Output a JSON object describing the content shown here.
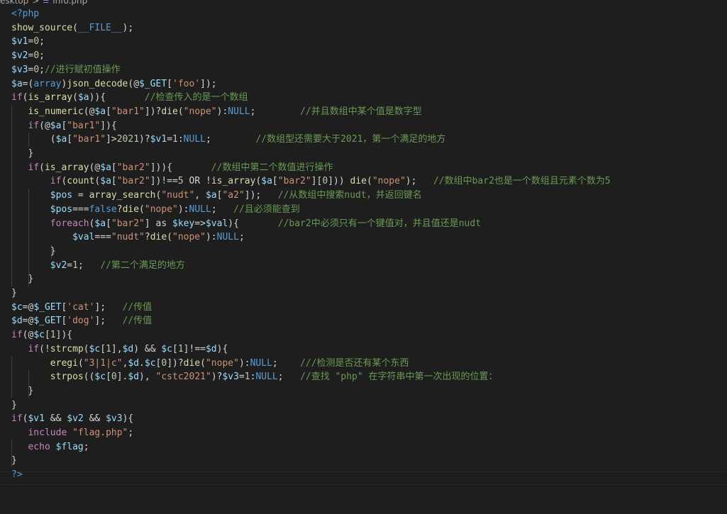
{
  "breadcrumb": {
    "folder": "esktop",
    "separator": ">",
    "file_icon": "php-file-icon",
    "file_name": "info.php"
  },
  "code": {
    "lines": [
      [
        [
          "t-tag",
          "<?php"
        ]
      ],
      [
        [
          "t-fn",
          "show_source"
        ],
        [
          "t-plain",
          "("
        ],
        [
          "t-const",
          "__FILE__"
        ],
        [
          "t-plain",
          ");"
        ]
      ],
      [
        [
          "t-var",
          "$v1"
        ],
        [
          "t-plain",
          "="
        ],
        [
          "t-num",
          "0"
        ],
        [
          "t-plain",
          ";"
        ]
      ],
      [
        [
          "t-var",
          "$v2"
        ],
        [
          "t-plain",
          "="
        ],
        [
          "t-num",
          "0"
        ],
        [
          "t-plain",
          ";"
        ]
      ],
      [
        [
          "t-var",
          "$v3"
        ],
        [
          "t-plain",
          "="
        ],
        [
          "t-num",
          "0"
        ],
        [
          "t-plain",
          ";"
        ],
        [
          "t-cmt",
          "//进行赋初值操作"
        ]
      ],
      [
        [
          "t-var",
          "$a"
        ],
        [
          "t-plain",
          "=("
        ],
        [
          "t-const",
          "array"
        ],
        [
          "t-plain",
          ")"
        ],
        [
          "t-fn",
          "json_decode"
        ],
        [
          "t-plain",
          "(@"
        ],
        [
          "t-var",
          "$_GET"
        ],
        [
          "t-plain",
          "["
        ],
        [
          "t-str",
          "'foo'"
        ],
        [
          "t-plain",
          "]);"
        ]
      ],
      [
        [
          "t-kw",
          "if"
        ],
        [
          "t-plain",
          "("
        ],
        [
          "t-fn",
          "is_array"
        ],
        [
          "t-plain",
          "("
        ],
        [
          "t-var",
          "$a"
        ],
        [
          "t-plain",
          ")){       "
        ],
        [
          "t-cmt",
          "//检查传入的是一个数组"
        ]
      ],
      [
        [
          "t-plain",
          "   "
        ],
        [
          "t-fn",
          "is_numeric"
        ],
        [
          "t-plain",
          "(@"
        ],
        [
          "t-var",
          "$a"
        ],
        [
          "t-plain",
          "["
        ],
        [
          "t-str",
          "\"bar1\""
        ],
        [
          "t-plain",
          "])?"
        ],
        [
          "t-fn",
          "die"
        ],
        [
          "t-plain",
          "("
        ],
        [
          "t-str",
          "\"nope\""
        ],
        [
          "t-plain",
          "):"
        ],
        [
          "t-const",
          "NULL"
        ],
        [
          "t-plain",
          ";        "
        ],
        [
          "t-cmt",
          "//并且数组中某个值是数字型"
        ]
      ],
      [
        [
          "t-plain",
          "   "
        ],
        [
          "t-kw",
          "if"
        ],
        [
          "t-plain",
          "(@"
        ],
        [
          "t-var",
          "$a"
        ],
        [
          "t-plain",
          "["
        ],
        [
          "t-str",
          "\"bar1\""
        ],
        [
          "t-plain",
          "]){"
        ]
      ],
      [
        [
          "t-plain",
          "       ("
        ],
        [
          "t-var",
          "$a"
        ],
        [
          "t-plain",
          "["
        ],
        [
          "t-str",
          "\"bar1\""
        ],
        [
          "t-plain",
          "]>"
        ],
        [
          "t-num",
          "2021"
        ],
        [
          "t-plain",
          ")?"
        ],
        [
          "t-var",
          "$v1"
        ],
        [
          "t-plain",
          "="
        ],
        [
          "t-num",
          "1"
        ],
        [
          "t-plain",
          ":"
        ],
        [
          "t-const",
          "NULL"
        ],
        [
          "t-plain",
          ";        "
        ],
        [
          "t-cmt",
          "//数组型还需要大于2021，第一个满足的地方"
        ]
      ],
      [
        [
          "t-plain",
          "   }"
        ]
      ],
      [
        [
          "t-plain",
          "   "
        ],
        [
          "t-kw",
          "if"
        ],
        [
          "t-plain",
          "("
        ],
        [
          "t-fn",
          "is_array"
        ],
        [
          "t-plain",
          "(@"
        ],
        [
          "t-var",
          "$a"
        ],
        [
          "t-plain",
          "["
        ],
        [
          "t-str",
          "\"bar2\""
        ],
        [
          "t-plain",
          "])){       "
        ],
        [
          "t-cmt",
          "//数组中第二个数值进行操作"
        ]
      ],
      [
        [
          "t-plain",
          "       "
        ],
        [
          "t-kw",
          "if"
        ],
        [
          "t-plain",
          "("
        ],
        [
          "t-fn",
          "count"
        ],
        [
          "t-plain",
          "("
        ],
        [
          "t-var",
          "$a"
        ],
        [
          "t-plain",
          "["
        ],
        [
          "t-str",
          "\"bar2\""
        ],
        [
          "t-plain",
          "])!=="
        ],
        [
          "t-num",
          "5"
        ],
        [
          "t-plain",
          " OR !"
        ],
        [
          "t-fn",
          "is_array"
        ],
        [
          "t-plain",
          "("
        ],
        [
          "t-var",
          "$a"
        ],
        [
          "t-plain",
          "["
        ],
        [
          "t-str",
          "\"bar2\""
        ],
        [
          "t-plain",
          "]["
        ],
        [
          "t-num",
          "0"
        ],
        [
          "t-plain",
          "])) "
        ],
        [
          "t-fn",
          "die"
        ],
        [
          "t-plain",
          "("
        ],
        [
          "t-str",
          "\"nope\""
        ],
        [
          "t-plain",
          ");   "
        ],
        [
          "t-cmt",
          "//数组中bar2也是一个数组且元素个数为5"
        ]
      ],
      [
        [
          "t-plain",
          "       "
        ],
        [
          "t-var",
          "$pos"
        ],
        [
          "t-plain",
          " = "
        ],
        [
          "t-fn",
          "array_search"
        ],
        [
          "t-plain",
          "("
        ],
        [
          "t-str",
          "\"nudt\""
        ],
        [
          "t-plain",
          ", "
        ],
        [
          "t-var",
          "$a"
        ],
        [
          "t-plain",
          "["
        ],
        [
          "t-str",
          "\"a2\""
        ],
        [
          "t-plain",
          "]);   "
        ],
        [
          "t-cmt",
          "//从数组中搜索nudt，并返回键名"
        ]
      ],
      [
        [
          "t-plain",
          "       "
        ],
        [
          "t-var",
          "$pos"
        ],
        [
          "t-plain",
          "==="
        ],
        [
          "t-const",
          "false"
        ],
        [
          "t-plain",
          "?"
        ],
        [
          "t-fn",
          "die"
        ],
        [
          "t-plain",
          "("
        ],
        [
          "t-str",
          "\"nope\""
        ],
        [
          "t-plain",
          "):"
        ],
        [
          "t-const",
          "NULL"
        ],
        [
          "t-plain",
          ";   "
        ],
        [
          "t-cmt",
          "//且必须能查到"
        ]
      ],
      [
        [
          "t-plain",
          "       "
        ],
        [
          "t-kw",
          "foreach"
        ],
        [
          "t-plain",
          "("
        ],
        [
          "t-var",
          "$a"
        ],
        [
          "t-plain",
          "["
        ],
        [
          "t-str",
          "\"bar2\""
        ],
        [
          "t-plain",
          "] as "
        ],
        [
          "t-var",
          "$key"
        ],
        [
          "t-plain",
          "=>"
        ],
        [
          "t-var",
          "$val"
        ],
        [
          "t-plain",
          "){       "
        ],
        [
          "t-cmt",
          "//bar2中必须只有一个键值对，并且值还是nudt"
        ]
      ],
      [
        [
          "t-plain",
          "           "
        ],
        [
          "t-var",
          "$val"
        ],
        [
          "t-plain",
          "==="
        ],
        [
          "t-str",
          "\"nudt\""
        ],
        [
          "t-plain",
          "?"
        ],
        [
          "t-fn",
          "die"
        ],
        [
          "t-plain",
          "("
        ],
        [
          "t-str",
          "\"nope\""
        ],
        [
          "t-plain",
          "):"
        ],
        [
          "t-const",
          "NULL"
        ],
        [
          "t-plain",
          ";"
        ]
      ],
      [
        [
          "t-plain",
          "       }"
        ]
      ],
      [
        [
          "t-plain",
          "       "
        ],
        [
          "t-var",
          "$v2"
        ],
        [
          "t-plain",
          "="
        ],
        [
          "t-num",
          "1"
        ],
        [
          "t-plain",
          ";   "
        ],
        [
          "t-cmt",
          "//第二个满足的地方"
        ]
      ],
      [
        [
          "t-plain",
          "   }"
        ]
      ],
      [
        [
          "t-plain",
          "}"
        ]
      ],
      [
        [
          "t-var",
          "$c"
        ],
        [
          "t-plain",
          "=@"
        ],
        [
          "t-var",
          "$_GET"
        ],
        [
          "t-plain",
          "["
        ],
        [
          "t-str",
          "'cat'"
        ],
        [
          "t-plain",
          "];   "
        ],
        [
          "t-cmt",
          "//传值"
        ]
      ],
      [
        [
          "t-var",
          "$d"
        ],
        [
          "t-plain",
          "=@"
        ],
        [
          "t-var",
          "$_GET"
        ],
        [
          "t-plain",
          "["
        ],
        [
          "t-str",
          "'dog'"
        ],
        [
          "t-plain",
          "];   "
        ],
        [
          "t-cmt",
          "//传值"
        ]
      ],
      [
        [
          "t-kw",
          "if"
        ],
        [
          "t-plain",
          "(@"
        ],
        [
          "t-var",
          "$c"
        ],
        [
          "t-plain",
          "["
        ],
        [
          "t-num",
          "1"
        ],
        [
          "t-plain",
          "]){"
        ]
      ],
      [
        [
          "t-plain",
          "   "
        ],
        [
          "t-kw",
          "if"
        ],
        [
          "t-plain",
          "(!"
        ],
        [
          "t-fn",
          "strcmp"
        ],
        [
          "t-plain",
          "("
        ],
        [
          "t-var",
          "$c"
        ],
        [
          "t-plain",
          "["
        ],
        [
          "t-num",
          "1"
        ],
        [
          "t-plain",
          "],"
        ],
        [
          "t-var",
          "$d"
        ],
        [
          "t-plain",
          ") && "
        ],
        [
          "t-var",
          "$c"
        ],
        [
          "t-plain",
          "["
        ],
        [
          "t-num",
          "1"
        ],
        [
          "t-plain",
          "]!=="
        ],
        [
          "t-var",
          "$d"
        ],
        [
          "t-plain",
          "){"
        ]
      ],
      [
        [
          "t-plain",
          "       "
        ],
        [
          "t-fn",
          "eregi"
        ],
        [
          "t-plain",
          "("
        ],
        [
          "t-str",
          "\"3|1|c\""
        ],
        [
          "t-plain",
          ","
        ],
        [
          "t-var",
          "$d"
        ],
        [
          "t-plain",
          "."
        ],
        [
          "t-var",
          "$c"
        ],
        [
          "t-plain",
          "["
        ],
        [
          "t-num",
          "0"
        ],
        [
          "t-plain",
          "])?"
        ],
        [
          "t-fn",
          "die"
        ],
        [
          "t-plain",
          "("
        ],
        [
          "t-str",
          "\"nope\""
        ],
        [
          "t-plain",
          "):"
        ],
        [
          "t-const",
          "NULL"
        ],
        [
          "t-plain",
          ";    "
        ],
        [
          "t-cmt",
          "///检测是否还有某个东西"
        ]
      ],
      [
        [
          "t-plain",
          "       "
        ],
        [
          "t-fn",
          "strpos"
        ],
        [
          "t-plain",
          "(("
        ],
        [
          "t-var",
          "$c"
        ],
        [
          "t-plain",
          "["
        ],
        [
          "t-num",
          "0"
        ],
        [
          "t-plain",
          "]."
        ],
        [
          "t-var",
          "$d"
        ],
        [
          "t-plain",
          "), "
        ],
        [
          "t-str",
          "\"cstc2021\""
        ],
        [
          "t-plain",
          ")?"
        ],
        [
          "t-var",
          "$v3"
        ],
        [
          "t-plain",
          "="
        ],
        [
          "t-num",
          "1"
        ],
        [
          "t-plain",
          ":"
        ],
        [
          "t-const",
          "NULL"
        ],
        [
          "t-plain",
          ";   "
        ],
        [
          "t-cmt",
          "//查找 \"php\" 在字符串中第一次出现的位置："
        ]
      ],
      [
        [
          "t-plain",
          "   }"
        ]
      ],
      [
        [
          "t-plain",
          "}"
        ]
      ],
      [
        [
          "t-kw",
          "if"
        ],
        [
          "t-plain",
          "("
        ],
        [
          "t-var",
          "$v1"
        ],
        [
          "t-plain",
          " && "
        ],
        [
          "t-var",
          "$v2"
        ],
        [
          "t-plain",
          " && "
        ],
        [
          "t-var",
          "$v3"
        ],
        [
          "t-plain",
          "){"
        ]
      ],
      [
        [
          "t-plain",
          "   "
        ],
        [
          "t-kw",
          "include"
        ],
        [
          "t-plain",
          " "
        ],
        [
          "t-str",
          "\"flag.php\""
        ],
        [
          "t-plain",
          ";"
        ]
      ],
      [
        [
          "t-plain",
          "   "
        ],
        [
          "t-kw",
          "echo"
        ],
        [
          "t-plain",
          " "
        ],
        [
          "t-var",
          "$flag"
        ],
        [
          "t-plain",
          ";"
        ]
      ],
      [
        [
          "t-plain",
          "}"
        ]
      ],
      [
        [
          "t-tag",
          "?>"
        ]
      ]
    ]
  }
}
